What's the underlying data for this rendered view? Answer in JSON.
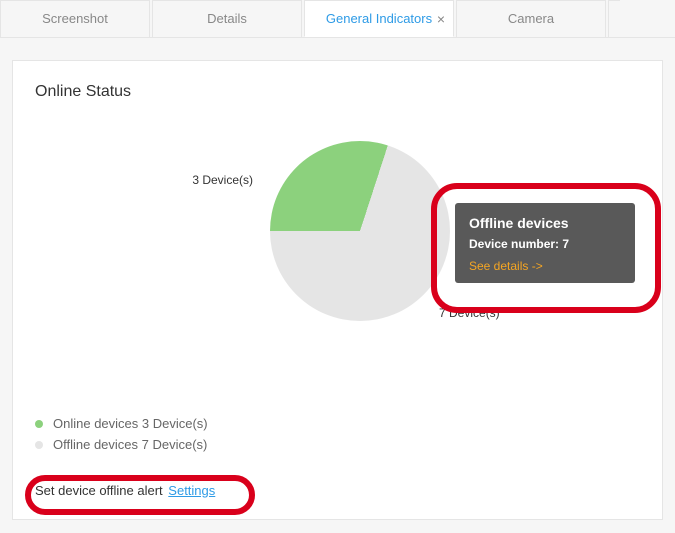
{
  "tabs": {
    "t0": "Screenshot",
    "t1": "Details",
    "t2": "General Indicators",
    "t3": "Camera"
  },
  "panel": {
    "title": "Online Status"
  },
  "chart_data": {
    "type": "pie",
    "title": "Online Status",
    "series": [
      {
        "name": "Online devices",
        "value": 3,
        "label": "3 Device(s)",
        "color": "#8cd17d"
      },
      {
        "name": "Offline devices",
        "value": 7,
        "label": "7 Device(s)",
        "color": "#e5e5e5"
      }
    ]
  },
  "labels": {
    "online_slice": "3 Device(s)",
    "offline_slice": "7 Device(s)"
  },
  "tooltip": {
    "title": "Offline devices",
    "number_line": "Device number:  7",
    "link": "See details ->"
  },
  "legend": {
    "online": "Online devices 3 Device(s)",
    "offline": "Offline devices 7 Device(s)"
  },
  "alert": {
    "text": "Set device offline alert",
    "link": "Settings"
  }
}
